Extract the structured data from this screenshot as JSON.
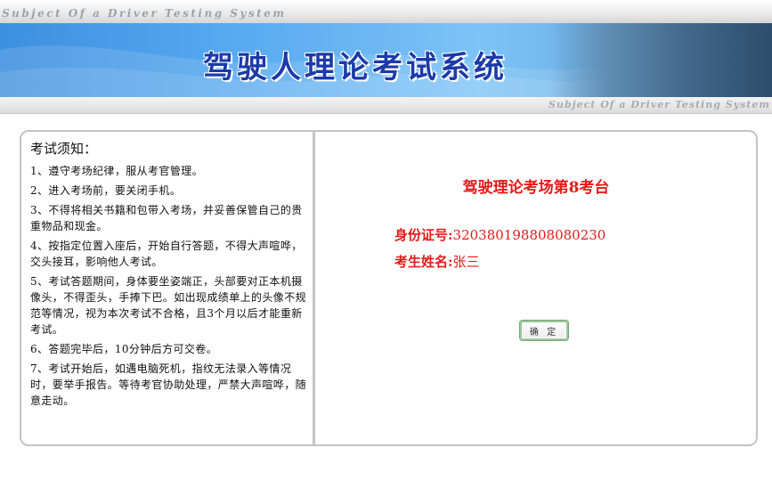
{
  "header": {
    "subtitle_top": "Subject Of a Driver Testing System",
    "title": "驾驶人理论考试系统",
    "subtitle_bottom": "Subject Of a Driver Testing System"
  },
  "notice": {
    "heading": "考试须知：",
    "rules": [
      "1、遵守考场纪律，服从考官管理。",
      "2、进入考场前，要关闭手机。",
      "3、不得将相关书籍和包带入考场，并妥善保管自己的贵重物品和现金。",
      "4、按指定位置入座后，开始自行答题，不得大声喧哗，交头接耳，影响他人考试。",
      "5、考试答题期间，身体要坐姿端正，头部要对正本机摄像头，不得歪头，手捧下巴。如出现成绩单上的头像不规范等情况，视为本次考试不合格，且3个月以后才能重新考试。",
      "6、答题完毕后，10分钟后方可交卷。",
      "7、考试开始后，如遇电脑死机，指纹无法录入等情况时，要举手报告。等待考官协助处理，严禁大声喧哗，随意走动。"
    ]
  },
  "info": {
    "station": "驾驶理论考场第8考台",
    "id_label": "身份证号:",
    "id_value": "320380198808080230",
    "name_label": "考生姓名:",
    "name_value": "张三",
    "confirm_label": "确 定"
  },
  "colors": {
    "title_blue": "#1c3aa8",
    "accent_red": "#e61919",
    "frame_gray": "#c4c4c4"
  }
}
